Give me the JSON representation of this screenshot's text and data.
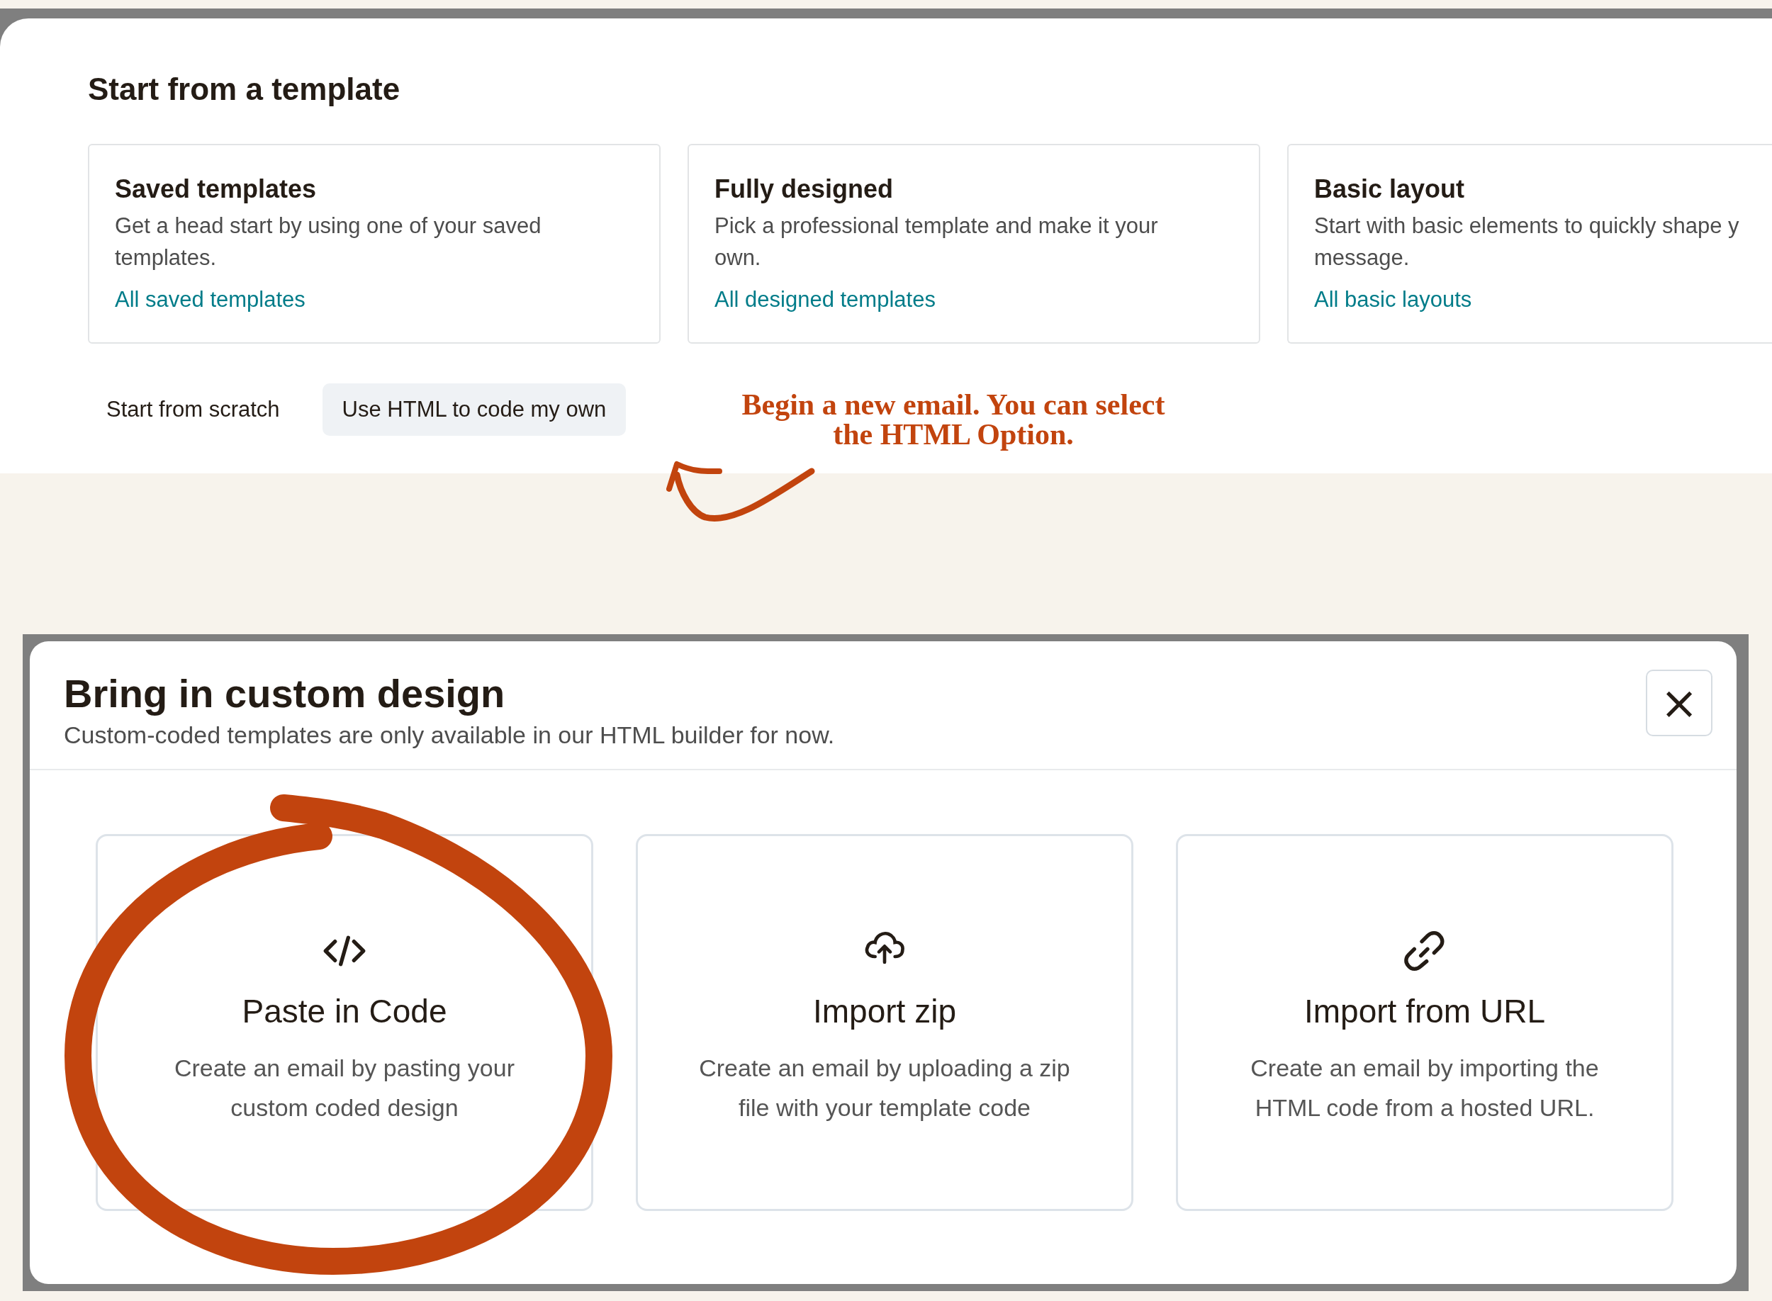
{
  "template_panel": {
    "title": "Start from a template",
    "cards": [
      {
        "title": "Saved templates",
        "description_lines": [
          "Get a head start by using one of your saved",
          "templates."
        ],
        "link": "All saved templates"
      },
      {
        "title": "Fully designed",
        "description_lines": [
          "Pick a professional template and make it your",
          "own."
        ],
        "link": "All designed templates"
      },
      {
        "title": "Basic layout",
        "description_lines": [
          "Start with basic elements to quickly shape y",
          "message."
        ],
        "link": "All basic layouts"
      }
    ],
    "scratch_label": "Start from scratch",
    "html_button": "Use HTML to code my own"
  },
  "annotation": {
    "text_lines": [
      "Begin a new email. You can select",
      "the HTML Option."
    ]
  },
  "modal": {
    "title": "Bring in custom design",
    "subtitle": "Custom-coded templates are only available in our HTML builder for now.",
    "close": "×",
    "options": [
      {
        "kind": "code",
        "title": "Paste in Code",
        "description_lines": [
          "Create an email by pasting your",
          "custom coded design"
        ]
      },
      {
        "kind": "upload",
        "title": "Import zip",
        "description_lines": [
          "Create an email by uploading a zip",
          "file with your template code"
        ]
      },
      {
        "kind": "link",
        "title": "Import from URL",
        "description_lines": [
          "Create an email by importing the",
          "HTML code from a hosted URL."
        ]
      }
    ]
  }
}
